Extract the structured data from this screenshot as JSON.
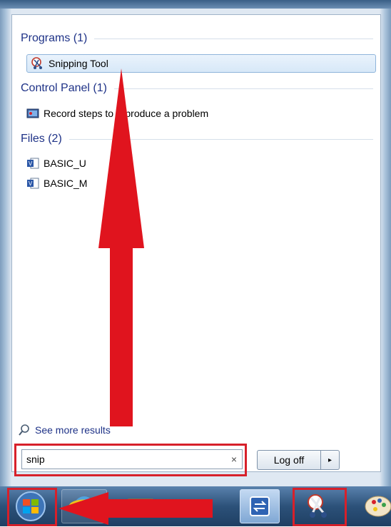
{
  "programs": {
    "header": "Programs (1)",
    "items": [
      {
        "label": "Snipping Tool",
        "icon": "snipping-tool-icon"
      }
    ]
  },
  "control_panel": {
    "header": "Control Panel (1)",
    "items": [
      {
        "label": "Record steps to reproduce a problem",
        "icon": "record-steps-icon"
      }
    ]
  },
  "files": {
    "header": "Files (2)",
    "items": [
      {
        "label": "BASIC_U",
        "icon": "visio-file-icon"
      },
      {
        "label": "BASIC_M",
        "icon": "visio-file-icon"
      }
    ]
  },
  "see_more": {
    "label": "See more results",
    "icon": "search-icon"
  },
  "search": {
    "value": "snip",
    "clear": "×"
  },
  "power": {
    "label": "Log off",
    "arrow": "▸"
  },
  "taskbar": {
    "items": [
      "start-orb-icon",
      "internet-explorer-icon",
      "file-explorer-icon",
      "media-icon",
      "switch-windows-icon",
      "snipping-tool-icon",
      "paint-icon"
    ]
  },
  "annotations": {
    "color": "#d7202a",
    "arrows": [
      "up-arrow",
      "left-arrow"
    ]
  }
}
